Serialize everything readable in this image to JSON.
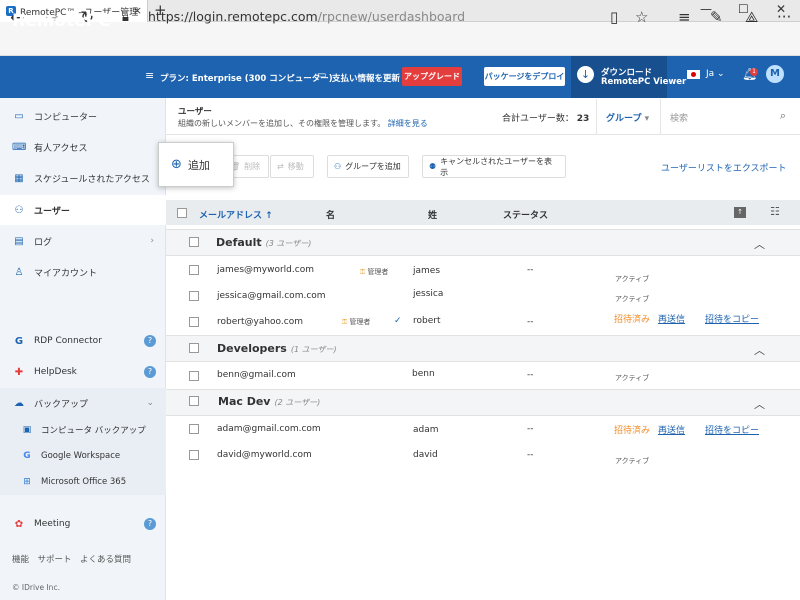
{
  "browser": {
    "tab_title": "RemotePC™ - ユーザー管理",
    "url_host": "https://login.remotepc.com",
    "url_path": "/rpcnew/userdashboard"
  },
  "header": {
    "logo": "RemotePC",
    "plan": "プラン: Enterprise (300 コンピューター)",
    "payment": "支払い情報を更新",
    "upgrade": "アップグレード",
    "deploy": "パッケージをデプロイ",
    "download_line1": "ダウンロード",
    "download_line2": "RemotePC Viewer",
    "language": "Ja",
    "notification_count": "1",
    "avatar": "M",
    "brand_color": "#1d63b0"
  },
  "sidebar": {
    "items": [
      {
        "label": "コンピューター",
        "icon": "monitor-icon"
      },
      {
        "label": "有人アクセス",
        "icon": "keyboard-icon"
      },
      {
        "label": "スケジュールされたアクセス",
        "icon": "calendar-icon"
      },
      {
        "label": "ユーザー",
        "icon": "users-icon"
      },
      {
        "label": "ログ",
        "icon": "log-icon"
      },
      {
        "label": "マイアカウント",
        "icon": "account-icon"
      }
    ],
    "products": [
      {
        "label": "RDP Connector"
      },
      {
        "label": "HelpDesk"
      },
      {
        "label": "バックアップ"
      }
    ],
    "backup_subitems": [
      {
        "label": "コンピュータ バックアップ"
      },
      {
        "label": "Google Workspace"
      },
      {
        "label": "Microsoft Office 365"
      }
    ],
    "meeting": "Meeting",
    "footer": "機能　サポート　よくある質問",
    "copyright": "© IDrive Inc."
  },
  "main": {
    "title": "ユーザー",
    "subtitle": "組織の新しいメンバーを追加し、その権限を管理します。",
    "details_link": "詳細を見る",
    "total_users": "合計ユーザー数：",
    "total_count": "23",
    "group_select": "グループ",
    "search_placeholder": "検索",
    "add_button": "追加",
    "delete_button": "削除",
    "move_button": "移動",
    "add_group_button": "グループを追加",
    "show_cancelled_button": "キャンセルされたユーザーを表示",
    "export_link": "ユーザーリストをエクスポート"
  },
  "table": {
    "headers": {
      "email": "メールアドレス ↑",
      "first": "名",
      "last": "姓",
      "status": "ステータス"
    },
    "groups": [
      {
        "name": "Default",
        "count": "(3 ユーザー)",
        "rows": [
          {
            "email": "james@myworld.com",
            "role": "管理者",
            "first": "",
            "last": "james",
            "status_dash": "--",
            "status": "アクティブ"
          },
          {
            "email": "jessica@gmail.com.com",
            "role": "",
            "first": "",
            "last": "jessica",
            "status_dash": "",
            "status": "アクティブ"
          },
          {
            "email": "robert@yahoo.com",
            "role": "管理者",
            "first": "",
            "last": "robert",
            "status_dash": "--",
            "invited": "招待済み",
            "resend": "再送信",
            "copy_invite": "招待をコピー"
          }
        ]
      },
      {
        "name": "Developers",
        "count": "(1 ユーザー)",
        "rows": [
          {
            "email": "benn@gmail.com",
            "last": "benn",
            "status_dash": "--",
            "status": "アクティブ"
          }
        ]
      },
      {
        "name": "Mac Dev",
        "count": "(2 ユーザー)",
        "rows": [
          {
            "email": "adam@gmail.com.com",
            "last": "adam",
            "status_dash": "--",
            "invited": "招待済み",
            "resend": "再送信",
            "copy_invite": "招待をコピー"
          },
          {
            "email": "david@myworld.com",
            "last": "david",
            "status_dash": "--",
            "status": "アクティブ"
          }
        ]
      }
    ]
  }
}
